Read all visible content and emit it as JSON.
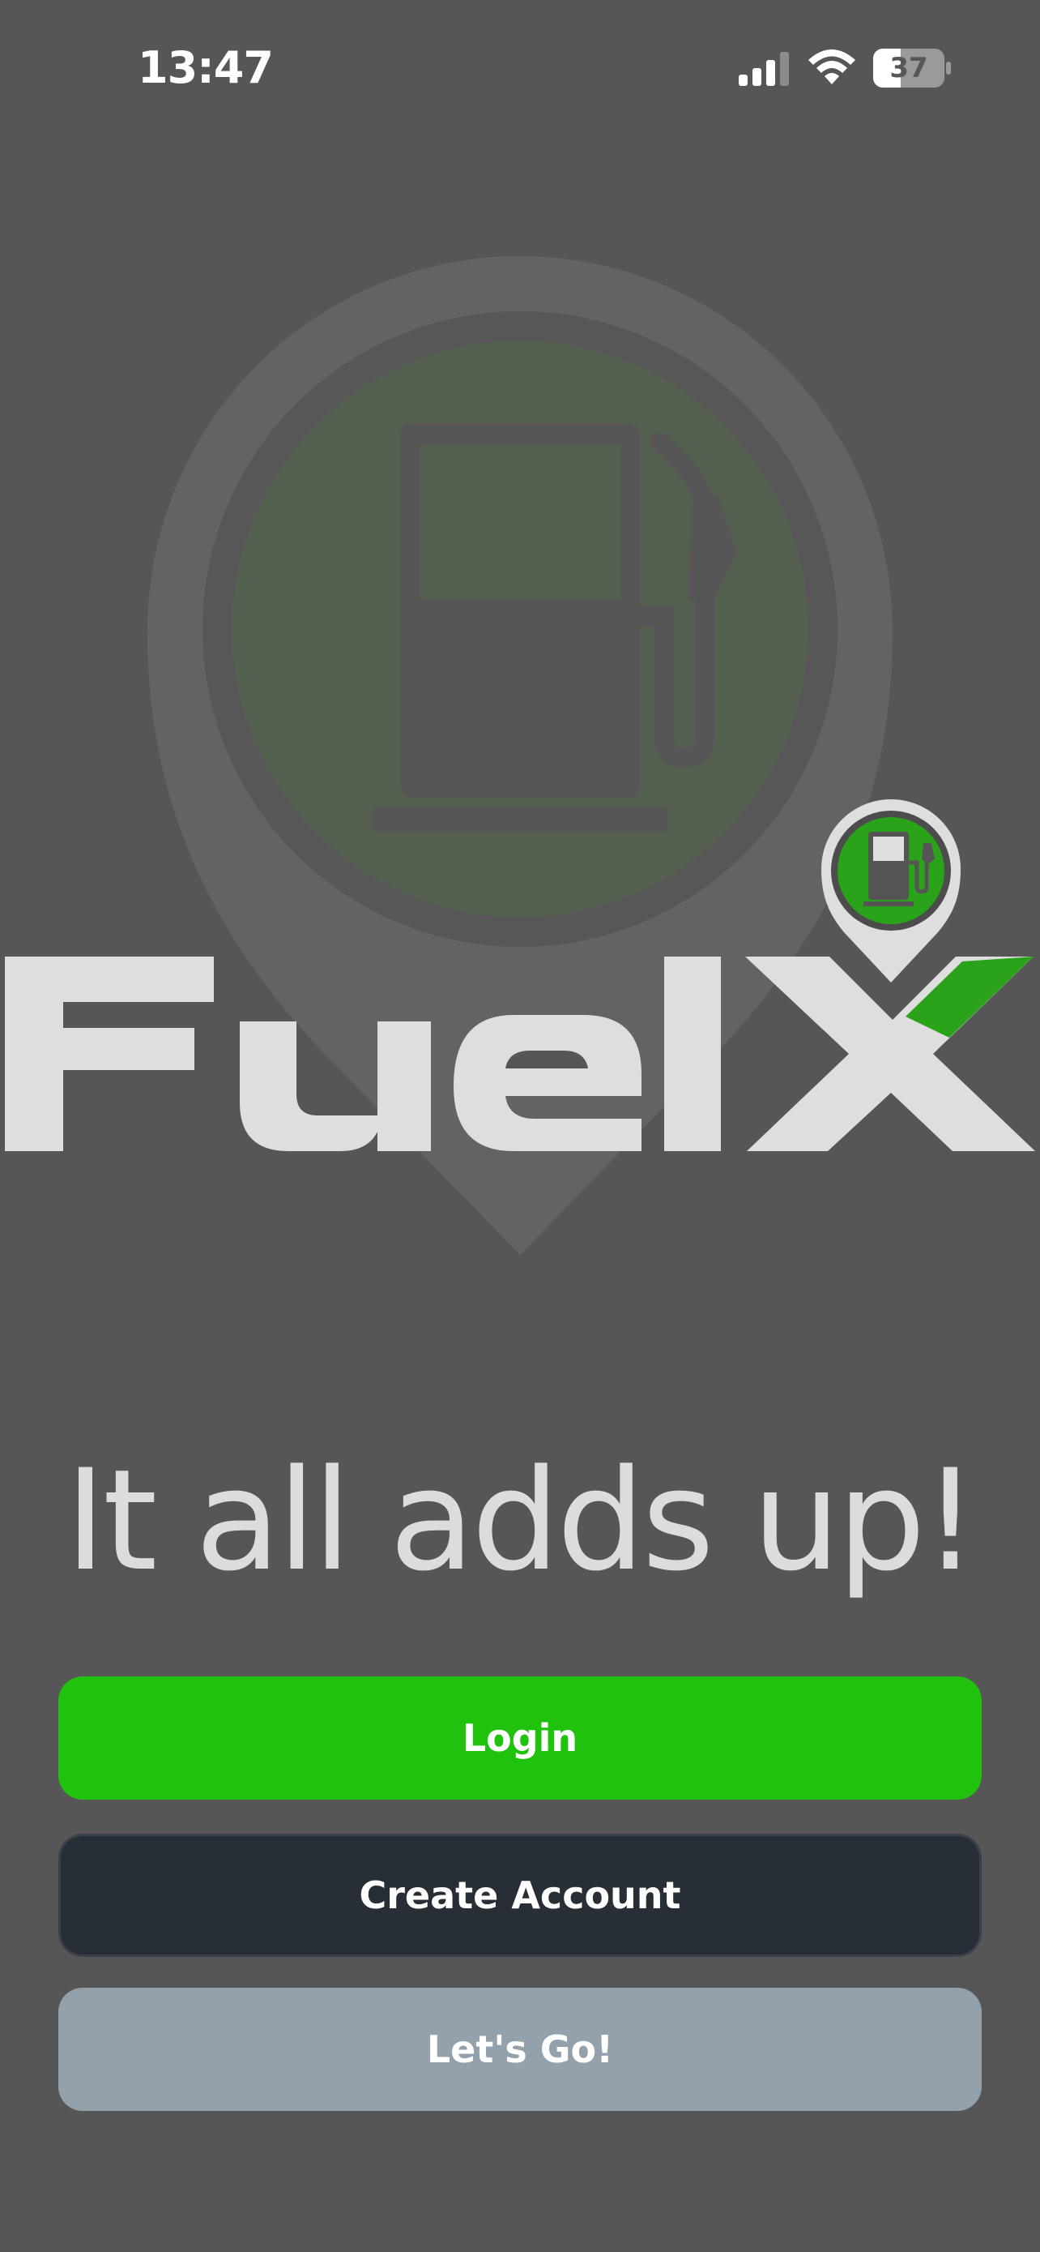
{
  "status_bar": {
    "time": "13:47",
    "battery_level": "37",
    "icons": [
      "signal-icon",
      "wifi-icon",
      "battery-icon"
    ]
  },
  "brand": {
    "logo_text": "FuelX",
    "tagline": "It all adds up!",
    "colors": {
      "background": "#565656",
      "brand_green": "#20c20e",
      "logo_gray": "#dedede"
    }
  },
  "actions": {
    "login_label": "Login",
    "create_account_label": "Create Account",
    "lets_go_label": "Let's Go!"
  },
  "button_colors": {
    "login": "#20c20e",
    "create_account": "#272e36",
    "lets_go": "#92a1ac"
  }
}
